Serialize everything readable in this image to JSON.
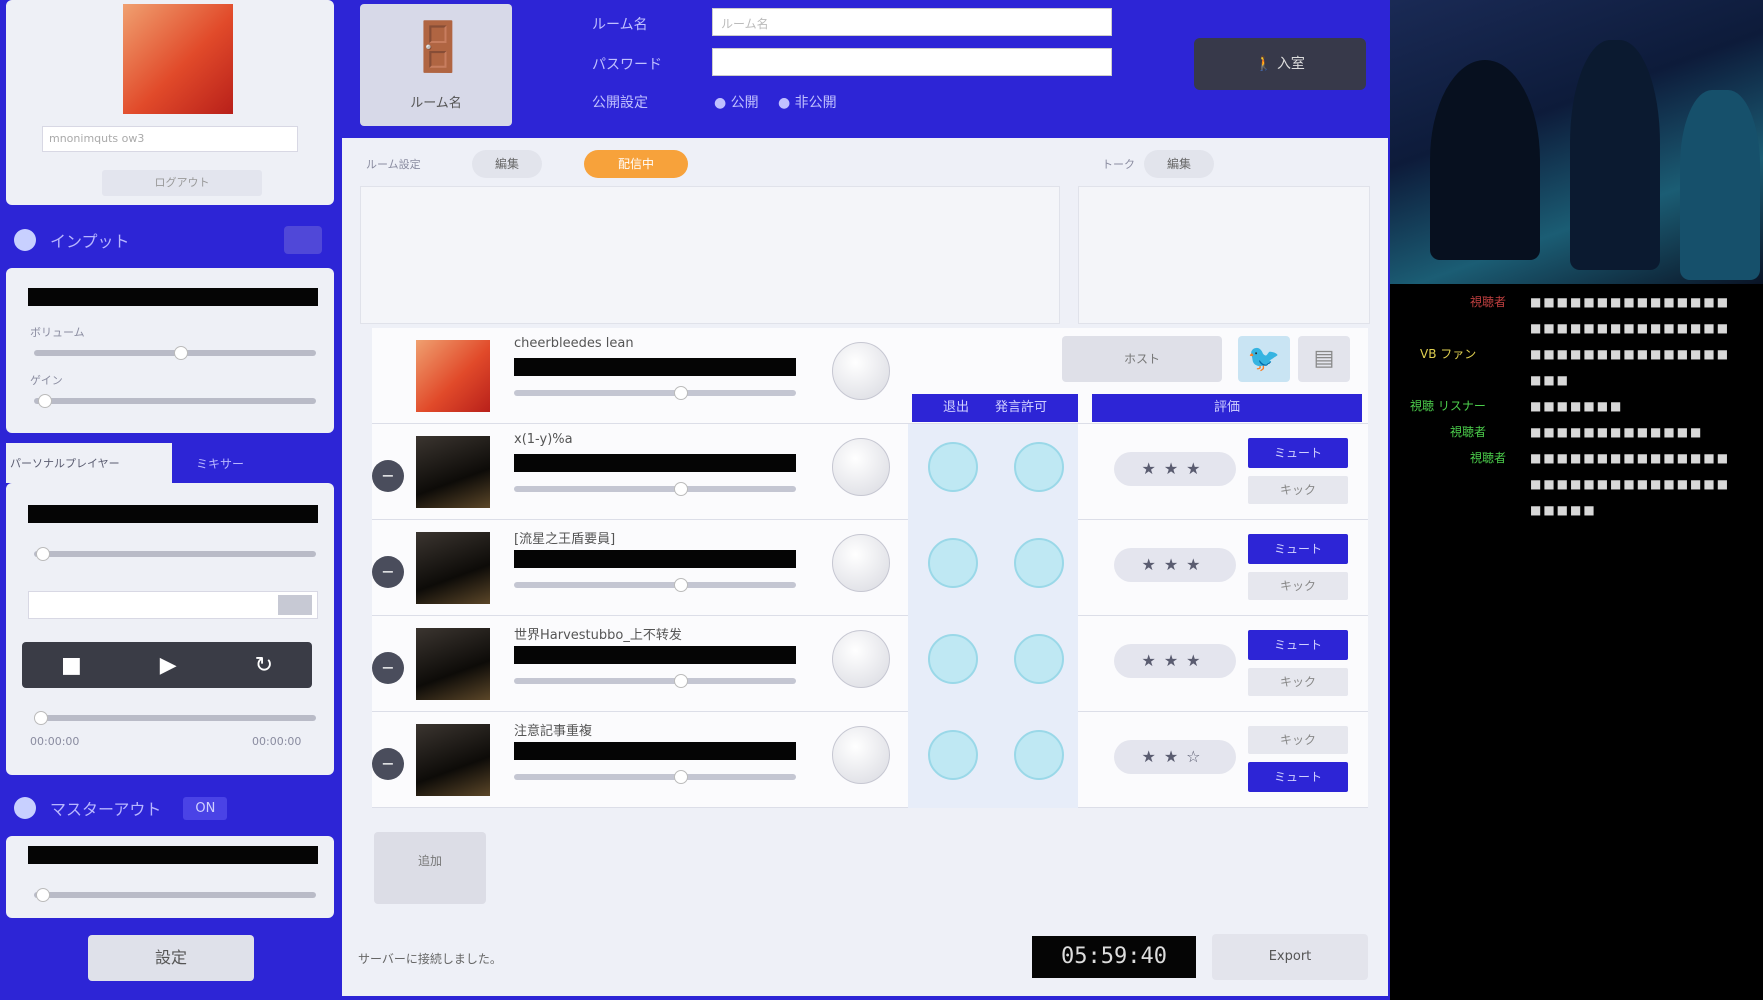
{
  "left": {
    "profile": {
      "username": "mnonimquts ow3",
      "logout": "ログアウト"
    },
    "input_section": {
      "title": "インプット",
      "volume_label": "ボリューム",
      "gain_label": "ゲイン"
    },
    "tabs": {
      "tab_a": "パーソナルプレイヤー",
      "tab_b": "ミキサー"
    },
    "master_section": {
      "title": "マスターアウト",
      "toggle": "ON"
    },
    "time_start": "00:00:00",
    "time_end": "00:00:00",
    "go_button": "設定"
  },
  "topbar": {
    "room_icon_label": "ルーム名",
    "fields": [
      {
        "label": "ルーム名",
        "value": "ルーム名"
      },
      {
        "label": "パスワード",
        "value": ""
      }
    ],
    "public_label": "公開設定",
    "radio_public": "● 公開",
    "radio_private": "● 非公開",
    "enter_button": "入室"
  },
  "main": {
    "filter": {
      "label": "ルーム設定",
      "btn1": "編集",
      "orange": "配信中",
      "right_label": "トーク",
      "btn2": "編集"
    },
    "col_heads": {
      "a": "退出",
      "b": "発言許可",
      "c": "評価"
    },
    "host_button": "ホスト",
    "participants": [
      {
        "name": "cheerbleedes lean",
        "host": true
      },
      {
        "name": "x(1-y)%a",
        "btn_top": "ミュート",
        "btn_bot": "キック",
        "stars": "★★★"
      },
      {
        "name": "[流星之王盾要員]",
        "btn_top": "ミュート",
        "btn_bot": "キック",
        "stars": "★★★"
      },
      {
        "name": "世界Harvestubbo_上不转发",
        "btn_top": "ミュート",
        "btn_bot": "キック",
        "stars": "★★★"
      },
      {
        "name": "注意記事重複",
        "btn_top": "ミュート",
        "btn_bot": "キック",
        "stars": "★★☆"
      }
    ],
    "add_button": "追加",
    "status_text": "サーバーに接続しました。",
    "timer": "05:59:40",
    "export_button": "Export"
  },
  "chat_log": [
    {
      "name": "視聴者",
      "color": "r",
      "text": "■■■■■■■■■■■■■■■"
    },
    {
      "name": "",
      "color": "r",
      "text": "■■■■■■■■■■■■■■■"
    },
    {
      "name": "VB ファン",
      "color": "y",
      "text": "■■■■■■■■■■■■■■■"
    },
    {
      "name": "",
      "color": "r",
      "text": "■■■"
    },
    {
      "name": "視聴 リスナー",
      "color": "g",
      "text": "■■■■■■■"
    },
    {
      "name": "視聴者",
      "color": "r",
      "text": "■■■■■■■■■■■■■"
    },
    {
      "name": "視聴者",
      "color": "g",
      "text": "■■■■■■■■■■■■■■■"
    },
    {
      "name": "",
      "color": "r",
      "text": "■■■■■■■■■■■■■■■"
    },
    {
      "name": "",
      "color": "r",
      "text": "■■■■■"
    }
  ]
}
